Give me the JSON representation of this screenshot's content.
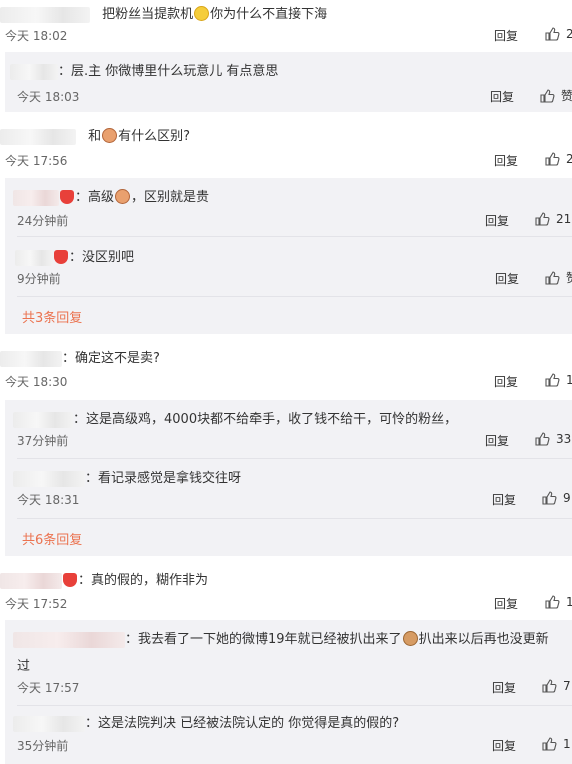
{
  "labels": {
    "reply": "回复",
    "separator": "："
  },
  "colors": {
    "more_link": "#eb7350",
    "sub_background": "#f2f2f5",
    "time": "#666666"
  },
  "comments": [
    {
      "text_before": "把粉丝当提款机",
      "emoji": "smile-emoji",
      "text_after": "你为什么不直接下海",
      "time": "今天 18:02",
      "like_count": "2"
    },
    {
      "text": "层.主 你微博里什么玩意儿 有点意思",
      "time": "今天 18:03",
      "like_count": "赞"
    },
    {
      "text_before": "和",
      "emoji": "bird-emoji",
      "text_after": "有什么区别?",
      "time": "今天 17:56",
      "like_count": "2"
    },
    {
      "text_before": "高级",
      "emoji": "bird-emoji",
      "text_after": "，区别就是贵",
      "time": "24分钟前",
      "like_count": "21"
    },
    {
      "text": "没区别吧",
      "time": "9分钟前",
      "like_count": "赞"
    },
    {
      "more": "共3条回复"
    },
    {
      "text": "确定这不是卖?",
      "time": "今天 18:30",
      "like_count": "1"
    },
    {
      "text": "这是高级鸡，4000块都不给牵手，收了钱不给干，可怜的粉丝，",
      "time": "37分钟前",
      "like_count": "33"
    },
    {
      "text": "看记录感觉是拿钱交往呀",
      "time": "今天 18:31",
      "like_count": "9"
    },
    {
      "more": "共6条回复"
    },
    {
      "text": "真的假的，糊作非为",
      "time": "今天 17:52",
      "like_count": "1"
    },
    {
      "text_before": "我去看了一下她的微博19年就已经被扒出来了",
      "emoji": "dog-emoji",
      "text_after": "扒出来以后再也没更新",
      "text_wrap": "过",
      "time": "今天 17:57",
      "like_count": "7"
    },
    {
      "text": "这是法院判决 已经被法院认定的 你觉得是真的假的?",
      "time": "35分钟前",
      "like_count": "1"
    }
  ]
}
